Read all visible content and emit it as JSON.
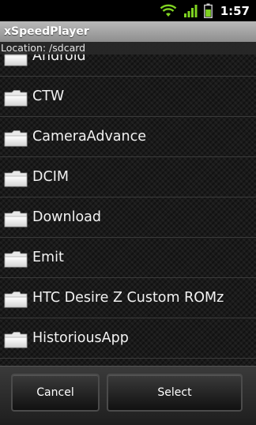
{
  "status_bar": {
    "wifi_icon": "wifi-icon",
    "signal_icon": "signal-bars-icon",
    "battery_icon": "battery-icon",
    "time": "1:57"
  },
  "app_title": "xSpeedPlayer",
  "location_label": "Location: /sdcard",
  "folders": [
    {
      "name": "Android",
      "icon": "folder-icon"
    },
    {
      "name": "CTW",
      "icon": "folder-icon"
    },
    {
      "name": "CameraAdvance",
      "icon": "folder-icon"
    },
    {
      "name": "DCIM",
      "icon": "folder-icon"
    },
    {
      "name": "Download",
      "icon": "folder-icon"
    },
    {
      "name": "Emit",
      "icon": "folder-icon"
    },
    {
      "name": "HTC Desire Z Custom ROMz",
      "icon": "folder-icon"
    },
    {
      "name": "HistoriousApp",
      "icon": "folder-icon"
    }
  ],
  "buttons": {
    "cancel": "Cancel",
    "select": "Select"
  },
  "colors": {
    "wifi": "#7fd321",
    "signal": "#7fd321",
    "battery": "#7fd321"
  }
}
